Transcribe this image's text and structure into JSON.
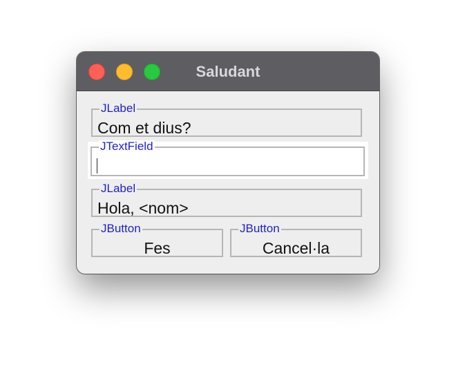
{
  "window": {
    "title": "Saludant"
  },
  "labels": {
    "question": {
      "type": "JLabel",
      "text": "Com et dius?"
    },
    "greeting": {
      "type": "JLabel",
      "text": "Hola, <nom>"
    }
  },
  "text_field": {
    "type": "JTextField",
    "value": ""
  },
  "buttons": {
    "do": {
      "type": "JButton",
      "label": "Fes"
    },
    "cancel": {
      "type": "JButton",
      "label": "Cancel·la"
    }
  },
  "colors": {
    "titlebar": "#5e5d62",
    "caption": "#1f1fd0",
    "close": "#fe5f57",
    "minimize": "#febc2e",
    "zoom": "#28c840"
  }
}
